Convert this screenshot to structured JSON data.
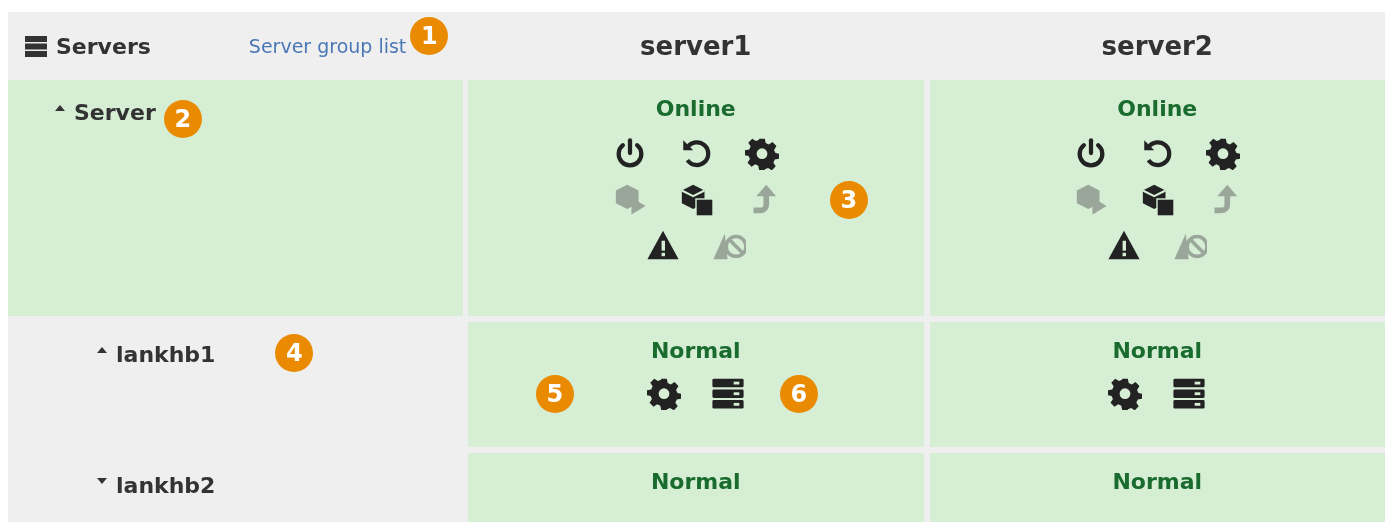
{
  "header": {
    "title": "Servers",
    "link": "Server group list",
    "callout": "1",
    "servers": [
      "server1",
      "server2"
    ]
  },
  "rows": [
    {
      "label": "Server",
      "expanded": true,
      "highlighted": true,
      "callout": "2",
      "cells": [
        {
          "status": "Online",
          "icon_rows": [
            [
              {
                "kind": "power",
                "disabled": false
              },
              {
                "kind": "restart",
                "disabled": false
              },
              {
                "kind": "gear",
                "disabled": false
              }
            ],
            [
              {
                "kind": "cube-play",
                "disabled": true
              },
              {
                "kind": "cube-stop",
                "disabled": false
              },
              {
                "kind": "arrow-up",
                "disabled": true
              }
            ],
            [
              {
                "kind": "warning",
                "disabled": false
              },
              {
                "kind": "warning-off",
                "disabled": true
              }
            ]
          ],
          "callout_after": "3"
        },
        {
          "status": "Online",
          "icon_rows": [
            [
              {
                "kind": "power",
                "disabled": false
              },
              {
                "kind": "restart",
                "disabled": false
              },
              {
                "kind": "gear",
                "disabled": false
              }
            ],
            [
              {
                "kind": "cube-play",
                "disabled": true
              },
              {
                "kind": "cube-stop",
                "disabled": false
              },
              {
                "kind": "arrow-up",
                "disabled": true
              }
            ],
            [
              {
                "kind": "warning",
                "disabled": false
              },
              {
                "kind": "warning-off",
                "disabled": true
              }
            ]
          ]
        }
      ]
    },
    {
      "label": "lankhb1",
      "expanded": true,
      "highlighted": false,
      "callout": "4",
      "cells": [
        {
          "status": "Normal",
          "icon_rows": [
            [
              {
                "kind": "gear",
                "disabled": false
              },
              {
                "kind": "server",
                "disabled": false
              }
            ]
          ],
          "callout_before": "5",
          "callout_after": "6"
        },
        {
          "status": "Normal",
          "icon_rows": [
            [
              {
                "kind": "gear",
                "disabled": false
              },
              {
                "kind": "server",
                "disabled": false
              }
            ]
          ]
        }
      ]
    },
    {
      "label": "lankhb2",
      "expanded": false,
      "highlighted": false,
      "cells": [
        {
          "status": "Normal"
        },
        {
          "status": "Normal"
        }
      ]
    }
  ]
}
